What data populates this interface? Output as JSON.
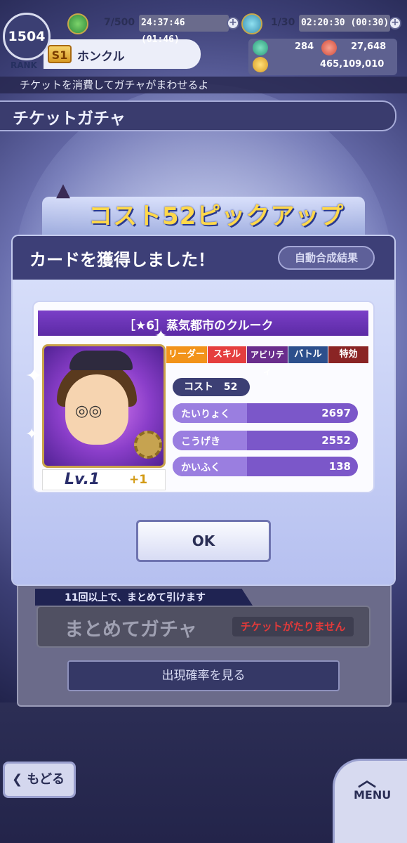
{
  "header": {
    "rank_number": "1504",
    "rank_label": "RANK",
    "rank_badge": "S1",
    "player_name": "ホンクル",
    "stamina": "7/500",
    "stamina_timer": "24:37:46 (01:46)",
    "battle_points": "1/30",
    "battle_timer": "02:20:30 (00:30)",
    "gems_a": "284",
    "gems_b": "27,648",
    "coins": "465,109,010",
    "plus_symbol": "+"
  },
  "subtitle": "チケットを消費してガチャがまわせるよ",
  "page_title": "チケットガチャ",
  "banner_text": "コスト52ピックアップ",
  "modal": {
    "title": "カードを獲得しました！",
    "fusion_result_button": "自動合成結果",
    "card_name": "［★6］蒸気都市のクルーク",
    "tabs": [
      {
        "label": "リーダー",
        "color": "#f2931a"
      },
      {
        "label": "スキル",
        "color": "#e53e3e"
      },
      {
        "label": "アビリティ",
        "color": "#6a2d8c"
      },
      {
        "label": "バトル",
        "color": "#2c4f8c"
      },
      {
        "label": "特効",
        "color": "#8a2424"
      }
    ],
    "cost_label": "コスト",
    "cost_value": "52",
    "stats": [
      {
        "label": "たいりょく",
        "value": "2697"
      },
      {
        "label": "こうげき",
        "value": "2552"
      },
      {
        "label": "かいふく",
        "value": "138"
      }
    ],
    "level_text": "Lv.1",
    "plus_text": "+1",
    "ok_button": "OK"
  },
  "lower": {
    "ribbon_text": "11回以上で、まとめて引けます",
    "bulk_button": "まとめてガチャ",
    "no_ticket": "チケットがたりません",
    "rate_button": "出現確率を見る"
  },
  "footer": {
    "back_button": "もどる",
    "menu_button": "MENU"
  }
}
